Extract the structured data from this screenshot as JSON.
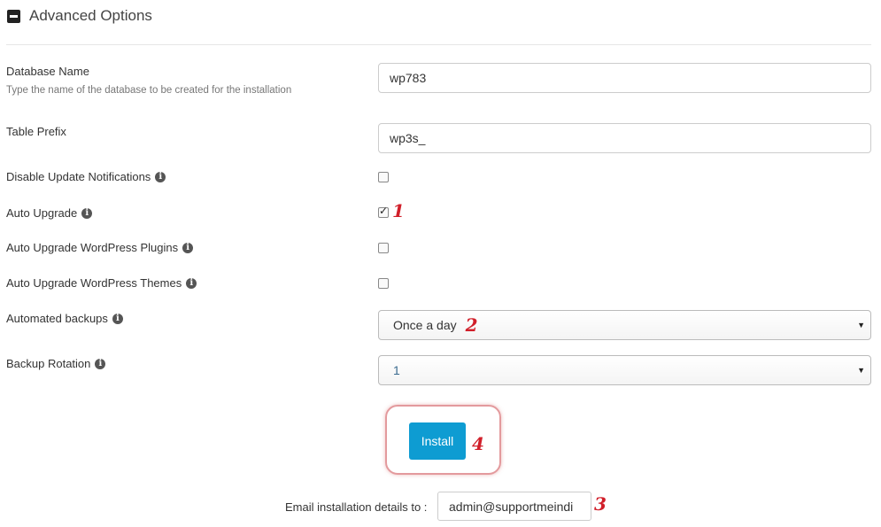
{
  "section": {
    "title": "Advanced Options",
    "toggle_icon": "collapse-minus-icon"
  },
  "fields": {
    "database_name": {
      "label": "Database Name",
      "hint": "Type the name of the database to be created for the installation",
      "value": "wp783"
    },
    "table_prefix": {
      "label": "Table Prefix",
      "value": "wp3s_"
    },
    "disable_update_notifications": {
      "label": "Disable Update Notifications",
      "checked": false
    },
    "auto_upgrade": {
      "label": "Auto Upgrade",
      "checked": true
    },
    "auto_upgrade_plugins": {
      "label": "Auto Upgrade WordPress Plugins",
      "checked": false
    },
    "auto_upgrade_themes": {
      "label": "Auto Upgrade WordPress Themes",
      "checked": false
    },
    "automated_backups": {
      "label": "Automated backups",
      "value": "Once a day"
    },
    "backup_rotation": {
      "label": "Backup Rotation",
      "value": "1"
    }
  },
  "install": {
    "label": "Install"
  },
  "email": {
    "label": "Email installation details to :",
    "value": "admin@supportmeindi"
  },
  "annotations": {
    "n1": "1",
    "n2": "2",
    "n3": "3",
    "n4": "4"
  },
  "colors": {
    "install_button": "#0e9cd2",
    "annotation": "#d11f2a",
    "highlight_frame": "#e39a9d"
  }
}
